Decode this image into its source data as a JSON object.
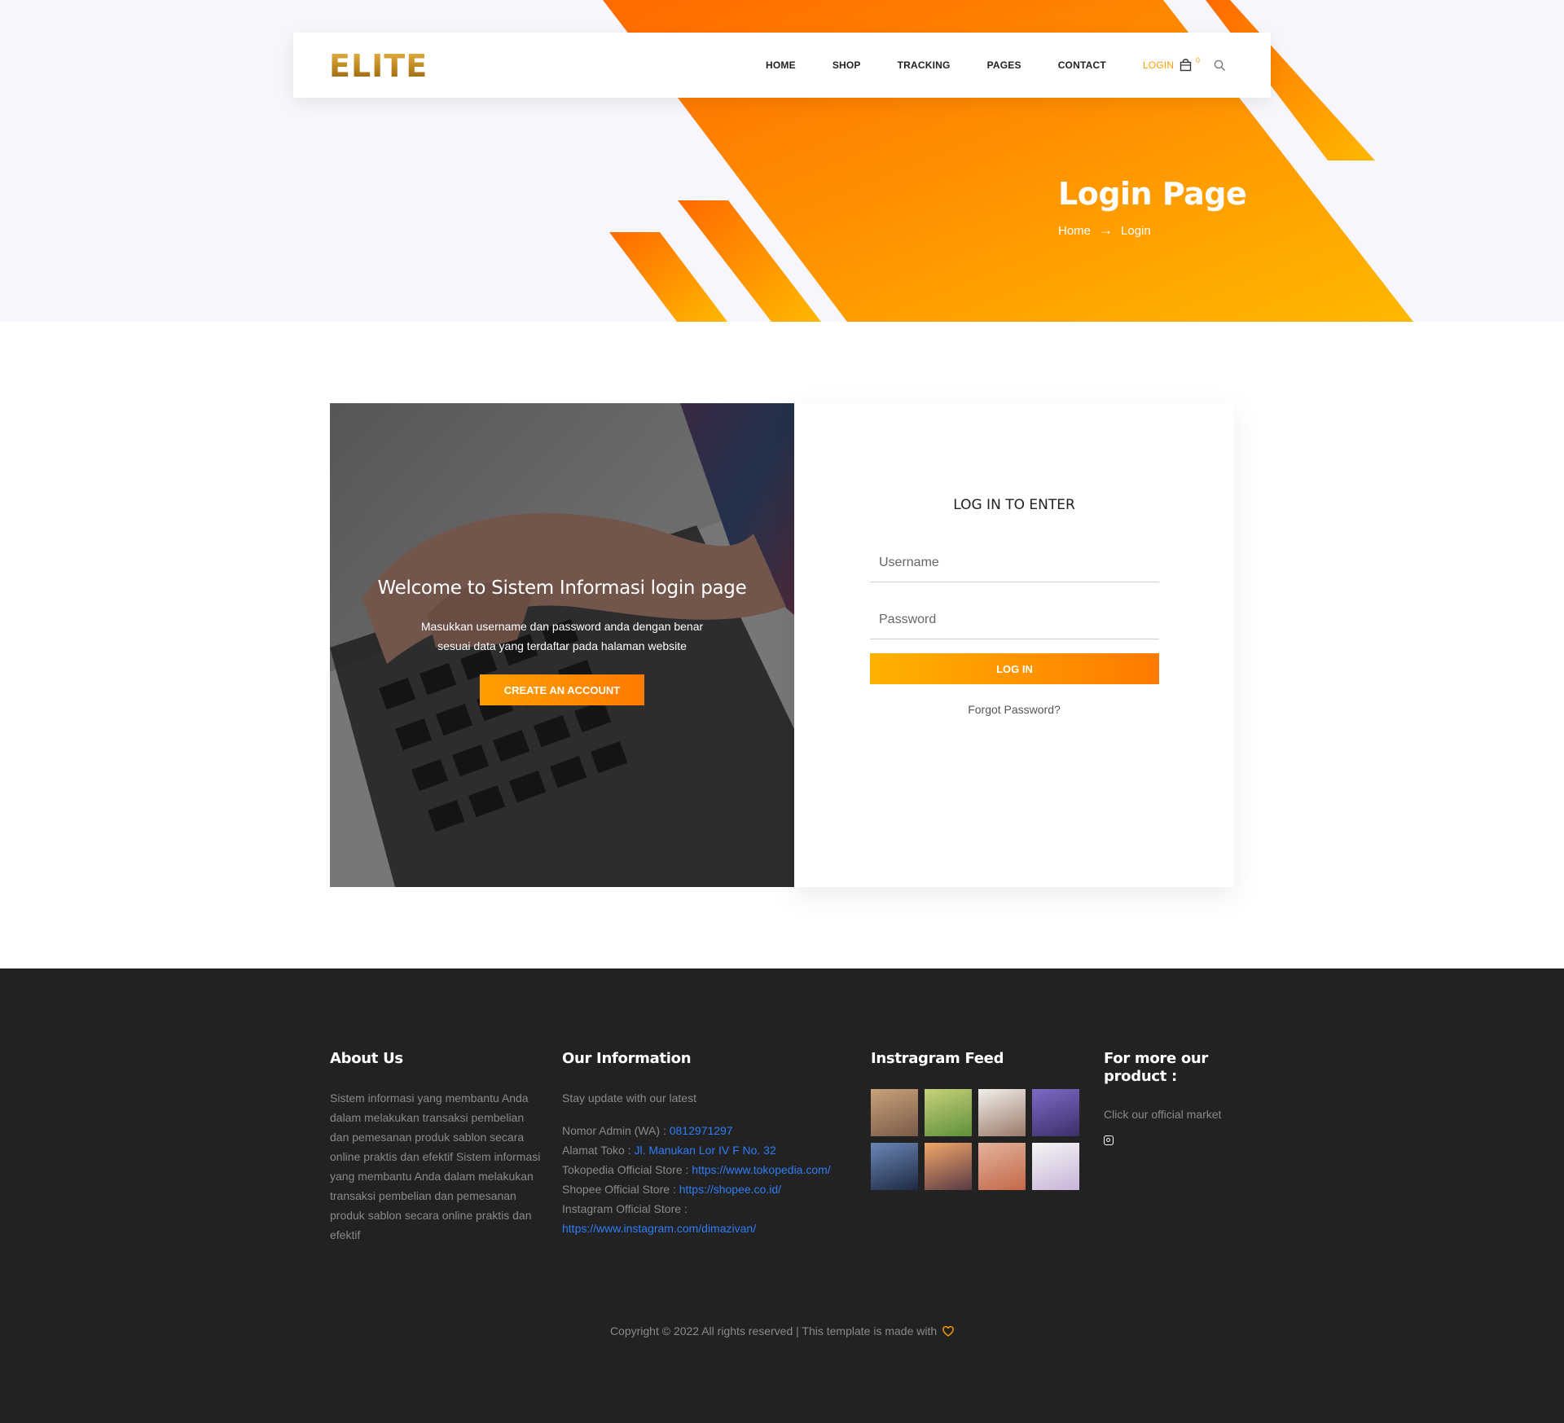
{
  "brand": {
    "logo_text": "ELITE",
    "accent": "#ff9c00"
  },
  "nav": {
    "items": [
      {
        "label": "HOME"
      },
      {
        "label": "SHOP"
      },
      {
        "label": "TRACKING"
      },
      {
        "label": "PAGES"
      },
      {
        "label": "CONTACT"
      },
      {
        "label": "LOGIN",
        "active": true
      }
    ],
    "cart_count": "0",
    "icons": [
      "shopping-bag-icon",
      "search-icon"
    ]
  },
  "hero": {
    "title": "Login Page",
    "breadcrumb": {
      "home": "Home",
      "current": "Login"
    },
    "colors": {
      "from": "#ff6a00",
      "to": "#ffb800",
      "background": "#f7f6fc"
    }
  },
  "welcome": {
    "title": "Welcome to Sistem Informasi login page",
    "subtitle": "Masukkan username dan password anda dengan benar sesuai data yang terdaftar pada halaman website",
    "button": "CREATE AN ACCOUNT"
  },
  "login": {
    "heading": "LOG IN TO ENTER",
    "username_placeholder": "Username",
    "password_placeholder": "Password",
    "button": "LOG IN",
    "forgot": "Forgot Password?"
  },
  "footer": {
    "about": {
      "title": "About Us",
      "text": "Sistem informasi yang membantu Anda dalam melakukan transaksi pembelian dan pemesanan produk sablon secara online praktis dan efektif Sistem informasi yang membantu Anda dalam melakukan transaksi pembelian dan pemesanan produk sablon secara online praktis dan efektif"
    },
    "info": {
      "title": "Our Information",
      "stay": "Stay update with our latest",
      "admin_label": "Nomor Admin (WA) :",
      "admin_value": "0812971297",
      "address_label": "Alamat Toko :",
      "address_value": "Jl. Manukan Lor IV F No. 32",
      "tokopedia_label": "Tokopedia Official Store :",
      "tokopedia_value": "https://www.tokopedia.com/",
      "shopee_label": "Shopee Official Store :",
      "shopee_value": "https://shopee.co.id/",
      "instagram_label": "Instagram Official Store :",
      "instagram_value": "https://www.instagram.com/dimazivan/"
    },
    "insta": {
      "title": "Instragram Feed",
      "photos": [
        {
          "top": "#c9a27a",
          "bottom": "#7a5a48"
        },
        {
          "top": "#c7d27a",
          "bottom": "#5f8f3a"
        },
        {
          "top": "#f2efea",
          "bottom": "#9a7a6a"
        },
        {
          "top": "#7d6ac7",
          "bottom": "#3d2f6a"
        },
        {
          "top": "#6a86b6",
          "bottom": "#1f2a44"
        },
        {
          "top": "#f2a76a",
          "bottom": "#5a3a44"
        },
        {
          "top": "#e2b39a",
          "bottom": "#c4684a"
        },
        {
          "top": "#f5f5f5",
          "bottom": "#c8b4d8"
        }
      ]
    },
    "more": {
      "title": "For more our product :",
      "text": "Click our official market",
      "icon": "instagram-icon"
    },
    "copyright": "Copyright © 2022 All rights reserved | This template is made with"
  }
}
